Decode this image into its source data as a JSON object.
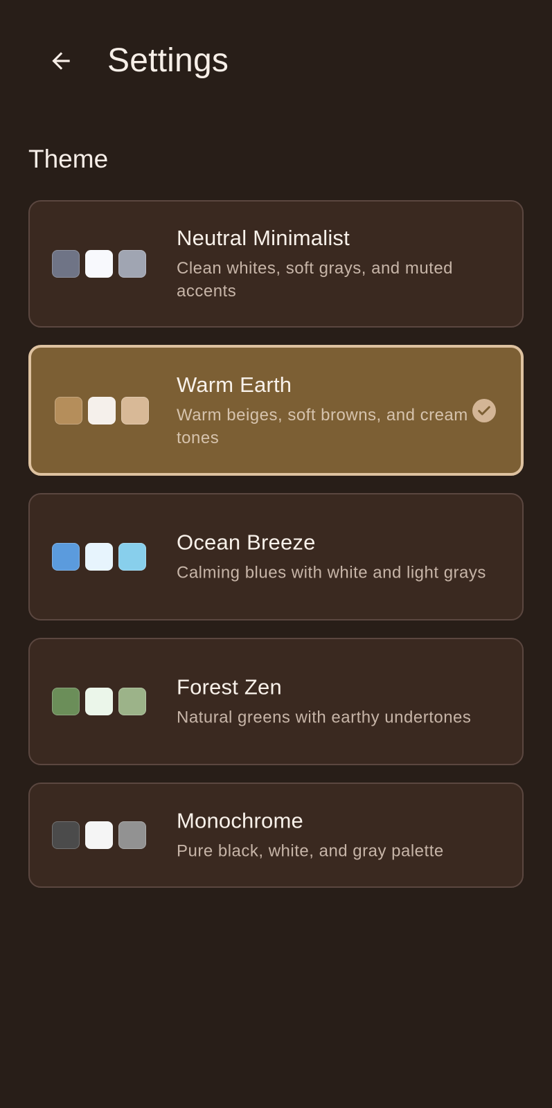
{
  "header": {
    "back_icon": "arrow-left-icon",
    "title": "Settings"
  },
  "section": {
    "title": "Theme"
  },
  "colors": {
    "background": "#281e18",
    "card": "#3a2920",
    "card_border": "#5b4740",
    "selected_card": "#7c5f34",
    "selected_border": "#dec2a0",
    "check": "#d3b596"
  },
  "themes": [
    {
      "name": "Neutral Minimalist",
      "description": "Clean whites, soft grays, and muted accents",
      "swatches": [
        "#6f7486",
        "#f8f9fd",
        "#a0a5b2"
      ],
      "selected": false
    },
    {
      "name": "Warm Earth",
      "description": "Warm beiges, soft browns, and cream tones",
      "swatches": [
        "#b58e5b",
        "#f5f0eb",
        "#d8b997"
      ],
      "selected": true,
      "check_icon": "checkmark-circle-icon"
    },
    {
      "name": "Ocean Breeze",
      "description": "Calming blues with white and light grays",
      "swatches": [
        "#5b9bdd",
        "#e7f4fd",
        "#88cfec"
      ],
      "selected": false
    },
    {
      "name": "Forest Zen",
      "description": "Natural greens with earthy undertones",
      "swatches": [
        "#6b8e59",
        "#ebf6ea",
        "#9cb389"
      ],
      "selected": false
    },
    {
      "name": "Monochrome",
      "description": "Pure black, white, and gray palette",
      "swatches": [
        "#4b4b4b",
        "#f5f5f5",
        "#929292"
      ],
      "selected": false
    }
  ]
}
